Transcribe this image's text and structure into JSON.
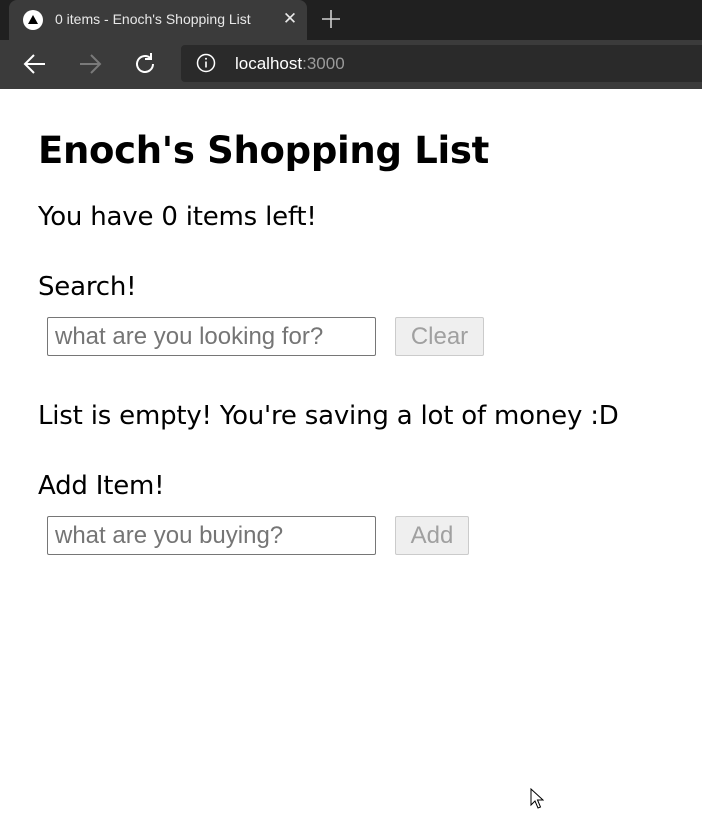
{
  "browser": {
    "tab": {
      "title": "0 items - Enoch's Shopping List",
      "close_glyph": "✕",
      "favicon": "triangle-logo-icon"
    },
    "new_tab_icon": "plus-icon",
    "nav": {
      "back_icon": "arrow-left-icon",
      "forward_icon": "arrow-right-icon",
      "reload_icon": "reload-icon"
    },
    "address": {
      "icon": "info-icon",
      "host": "localhost",
      "port": ":3000"
    }
  },
  "page": {
    "title": "Enoch's Shopping List",
    "items_left": "You have 0 items left!",
    "search": {
      "label": "Search!",
      "placeholder": "what are you looking for?",
      "value": "",
      "clear_label": "Clear"
    },
    "empty_message": "List is empty! You're saving a lot of money :D",
    "add": {
      "label": "Add Item!",
      "placeholder": "what are you buying?",
      "value": "",
      "add_label": "Add"
    }
  },
  "colors": {
    "tabstrip": "#202020",
    "toolbar": "#3b3b3b",
    "omnibox": "#2a2a2a",
    "disabled_button_bg": "#efefef",
    "disabled_button_text": "#a0a0a0"
  }
}
